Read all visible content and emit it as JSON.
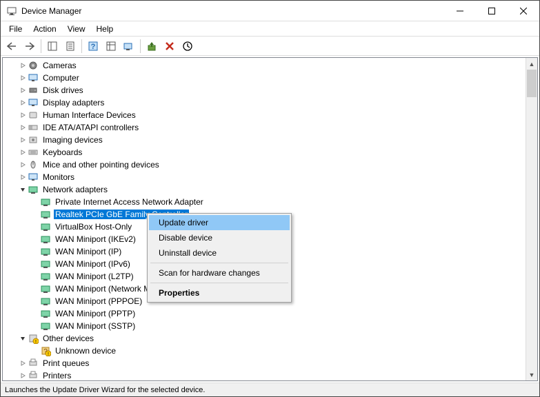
{
  "window": {
    "title": "Device Manager"
  },
  "menubar": {
    "items": [
      "File",
      "Action",
      "View",
      "Help"
    ]
  },
  "categories": [
    {
      "label": "Cameras",
      "icon": "camera",
      "expanded": false
    },
    {
      "label": "Computer",
      "icon": "computer",
      "expanded": false
    },
    {
      "label": "Disk drives",
      "icon": "disk",
      "expanded": false
    },
    {
      "label": "Display adapters",
      "icon": "display",
      "expanded": false
    },
    {
      "label": "Human Interface Devices",
      "icon": "hid",
      "expanded": false
    },
    {
      "label": "IDE ATA/ATAPI controllers",
      "icon": "ide",
      "expanded": false
    },
    {
      "label": "Imaging devices",
      "icon": "imaging",
      "expanded": false
    },
    {
      "label": "Keyboards",
      "icon": "keyboard",
      "expanded": false
    },
    {
      "label": "Mice and other pointing devices",
      "icon": "mouse",
      "expanded": false
    },
    {
      "label": "Monitors",
      "icon": "monitor",
      "expanded": false
    },
    {
      "label": "Network adapters",
      "icon": "network",
      "expanded": true,
      "children": [
        {
          "label": "Private Internet Access Network Adapter"
        },
        {
          "label": "Realtek PCIe GbE Family Controller",
          "selected": true
        },
        {
          "label": "VirtualBox Host-Only"
        },
        {
          "label": "WAN Miniport (IKEv2)"
        },
        {
          "label": "WAN Miniport (IP)"
        },
        {
          "label": "WAN Miniport (IPv6)"
        },
        {
          "label": "WAN Miniport (L2TP)"
        },
        {
          "label": "WAN Miniport (Network Monitor)"
        },
        {
          "label": "WAN Miniport (PPPOE)"
        },
        {
          "label": "WAN Miniport (PPTP)"
        },
        {
          "label": "WAN Miniport (SSTP)"
        }
      ]
    },
    {
      "label": "Other devices",
      "icon": "other",
      "warning": true,
      "expanded": true,
      "children": [
        {
          "label": "Unknown device",
          "warning": true
        }
      ]
    },
    {
      "label": "Print queues",
      "icon": "printer",
      "expanded": false
    },
    {
      "label": "Printers",
      "icon": "printer",
      "expanded": false
    }
  ],
  "context_menu": {
    "items": [
      {
        "label": "Update driver",
        "highlight": true
      },
      {
        "label": "Disable device"
      },
      {
        "label": "Uninstall device"
      },
      {
        "sep": true
      },
      {
        "label": "Scan for hardware changes"
      },
      {
        "sep": true
      },
      {
        "label": "Properties",
        "bold": true
      }
    ]
  },
  "statusbar": {
    "text": "Launches the Update Driver Wizard for the selected device."
  }
}
